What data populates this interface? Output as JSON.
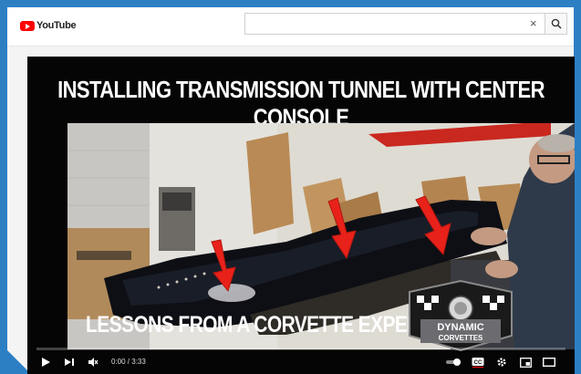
{
  "header": {
    "logo_text": "YouTube",
    "search": {
      "value": "",
      "placeholder": ""
    },
    "clear_label": "×"
  },
  "video": {
    "title_top": "INSTALLING TRANSMISSION TUNNEL WITH CENTER CONSOLE",
    "title_bottom": "LESSONS FROM A CORVETTE EXPERT",
    "badge_line1": "DYNAMIC",
    "badge_line2": "CORVETTES",
    "time_display": "0:00 / 3:33",
    "progress_fraction": 0.0,
    "cc_label": "CC"
  },
  "colors": {
    "accent": "#ff0000",
    "frame": "#2d7fc4",
    "arrow": "#e8221a"
  }
}
